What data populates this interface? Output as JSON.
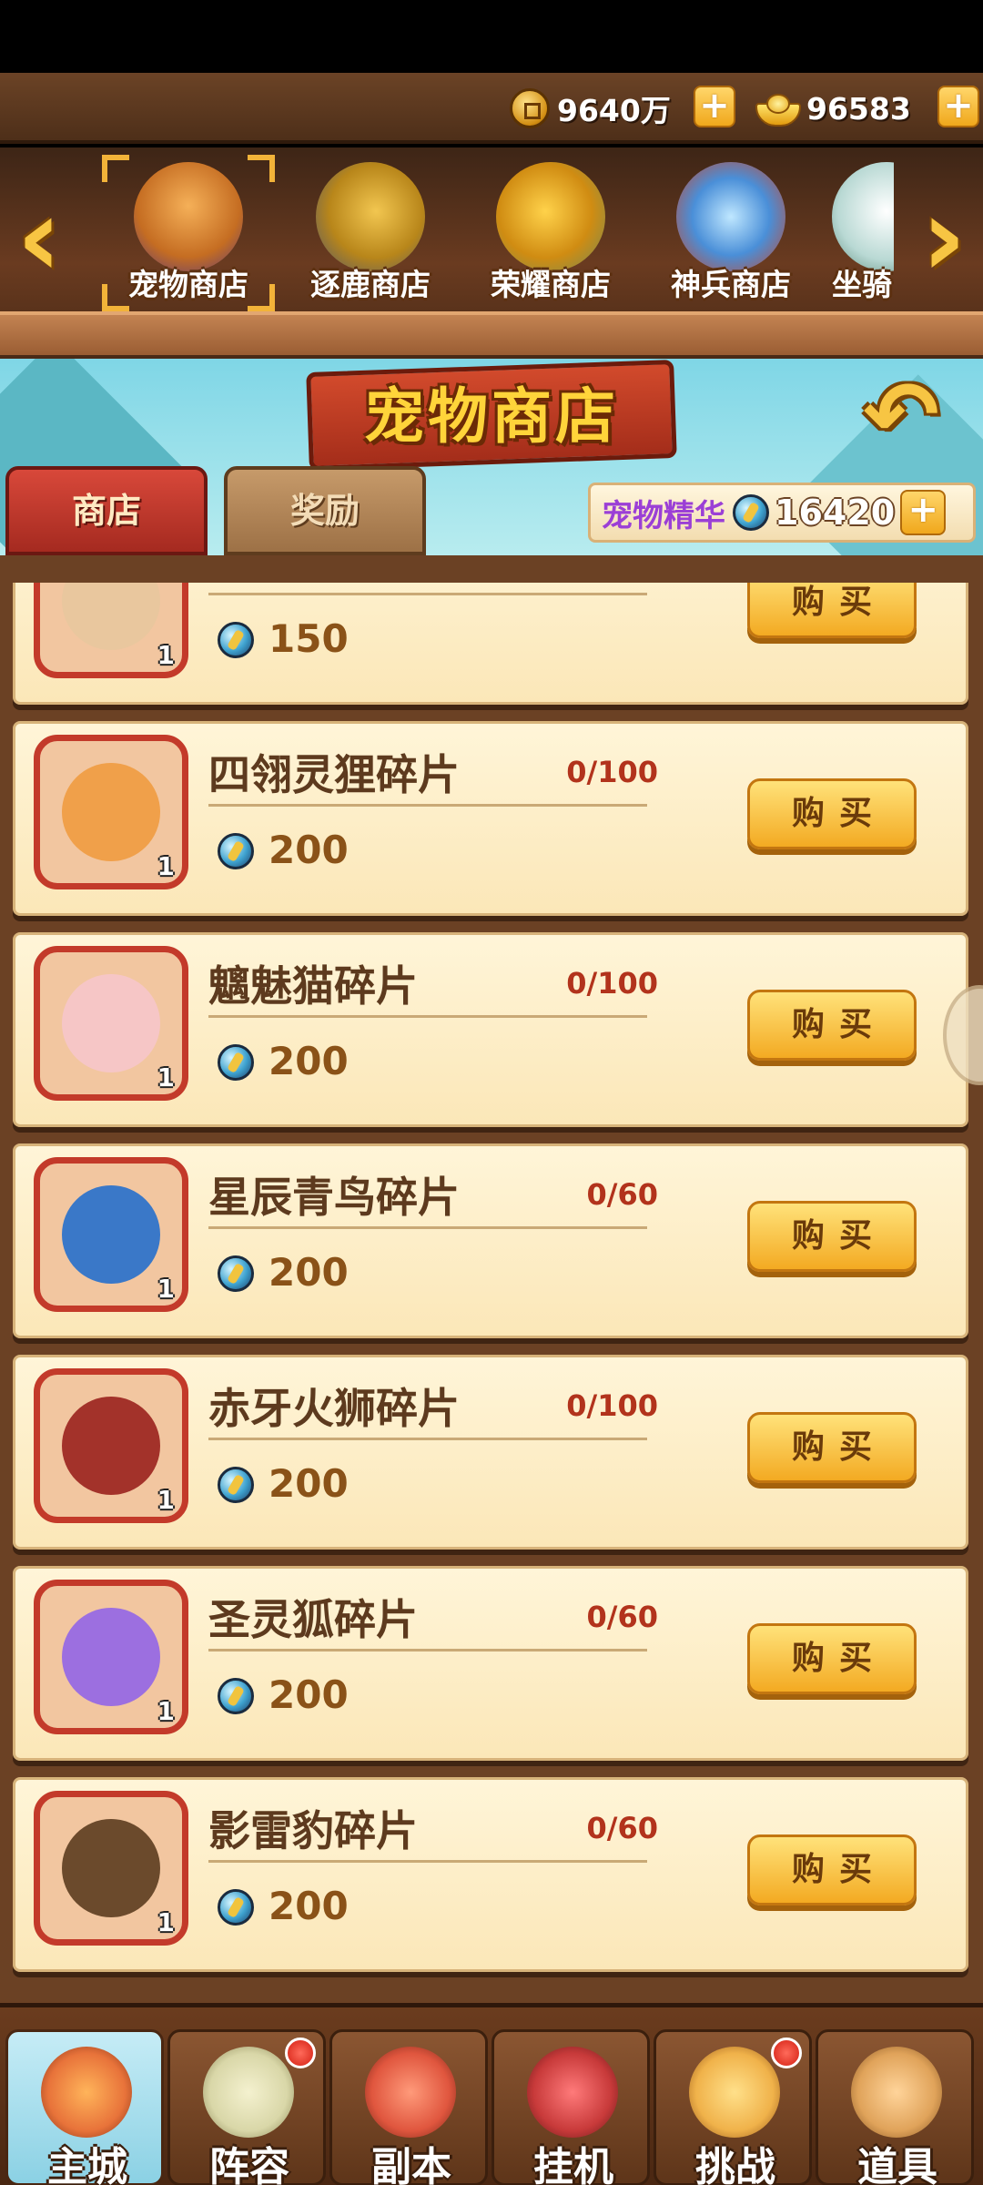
{
  "currency": {
    "coins": "9640万",
    "ingots": "96583"
  },
  "shop_tabs": [
    {
      "label": "宠物商店",
      "icon": "pet-shop-icon",
      "selected": true
    },
    {
      "label": "逐鹿商店",
      "icon": "chest-icon",
      "selected": false
    },
    {
      "label": "荣耀商店",
      "icon": "honor-medal-icon",
      "selected": false
    },
    {
      "label": "神兵商店",
      "icon": "weapon-icon",
      "selected": false
    },
    {
      "label": "坐骑",
      "icon": "mount-icon",
      "selected": false
    }
  ],
  "header": {
    "title": "宠物商店",
    "tabs": [
      {
        "label": "商店",
        "active": true
      },
      {
        "label": "奖励",
        "active": false
      }
    ],
    "essence_label": "宠物精华",
    "essence_value": "16420"
  },
  "items": [
    {
      "name": "",
      "count": "",
      "price": "150",
      "qty": "1",
      "buy": "购买",
      "color": "#e9c79e"
    },
    {
      "name": "四翎灵狸碎片",
      "count": "0/100",
      "price": "200",
      "qty": "1",
      "buy": "购买",
      "color": "#f0a04a"
    },
    {
      "name": "魑魅猫碎片",
      "count": "0/100",
      "price": "200",
      "qty": "1",
      "buy": "购买",
      "color": "#f6c6c6"
    },
    {
      "name": "星辰青鸟碎片",
      "count": "0/60",
      "price": "200",
      "qty": "1",
      "buy": "购买",
      "color": "#3a78c8"
    },
    {
      "name": "赤牙火狮碎片",
      "count": "0/100",
      "price": "200",
      "qty": "1",
      "buy": "购买",
      "color": "#a3322a"
    },
    {
      "name": "圣灵狐碎片",
      "count": "0/60",
      "price": "200",
      "qty": "1",
      "buy": "购买",
      "color": "#9c6fe0"
    },
    {
      "name": "影雷豹碎片",
      "count": "0/60",
      "price": "200",
      "qty": "1",
      "buy": "购买",
      "color": "#6b4a2c"
    }
  ],
  "bottom_nav": [
    {
      "label": "主城",
      "active": true,
      "badge": false,
      "color": "#e8733a"
    },
    {
      "label": "阵容",
      "active": false,
      "badge": true,
      "color": "#d9d7a8"
    },
    {
      "label": "副本",
      "active": false,
      "badge": false,
      "color": "#e0563e"
    },
    {
      "label": "挂机",
      "active": false,
      "badge": false,
      "color": "#c83a3a"
    },
    {
      "label": "挑战",
      "active": false,
      "badge": true,
      "color": "#f0b24a"
    },
    {
      "label": "道具",
      "active": false,
      "badge": false,
      "color": "#e0a35a"
    }
  ]
}
